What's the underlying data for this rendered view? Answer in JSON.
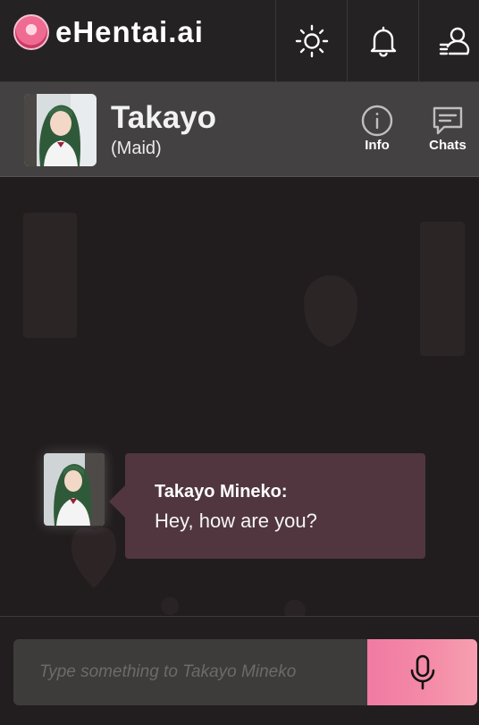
{
  "brand": {
    "name": "eHentai.ai",
    "logo_icon": "brand-avatar-logo"
  },
  "topbar": {
    "buttons": [
      {
        "icon": "sun-icon",
        "action": "toggle-theme"
      },
      {
        "icon": "bell-icon",
        "action": "notifications"
      },
      {
        "icon": "user-menu-icon",
        "action": "account-menu"
      }
    ]
  },
  "character": {
    "name": "Takayo",
    "role": "(Maid)",
    "actions": {
      "info_label": "Info",
      "chats_label": "Chats"
    }
  },
  "messages": [
    {
      "sender": "Takayo Mineko:",
      "text": "Hey, how are you?"
    }
  ],
  "composer": {
    "placeholder": "Type something to Takayo Mineko",
    "value": "",
    "mic_icon": "microphone-icon"
  },
  "colors": {
    "background": "#231f20",
    "header": "#434141",
    "bubble": "#513640",
    "accent": "#f07aa3"
  }
}
